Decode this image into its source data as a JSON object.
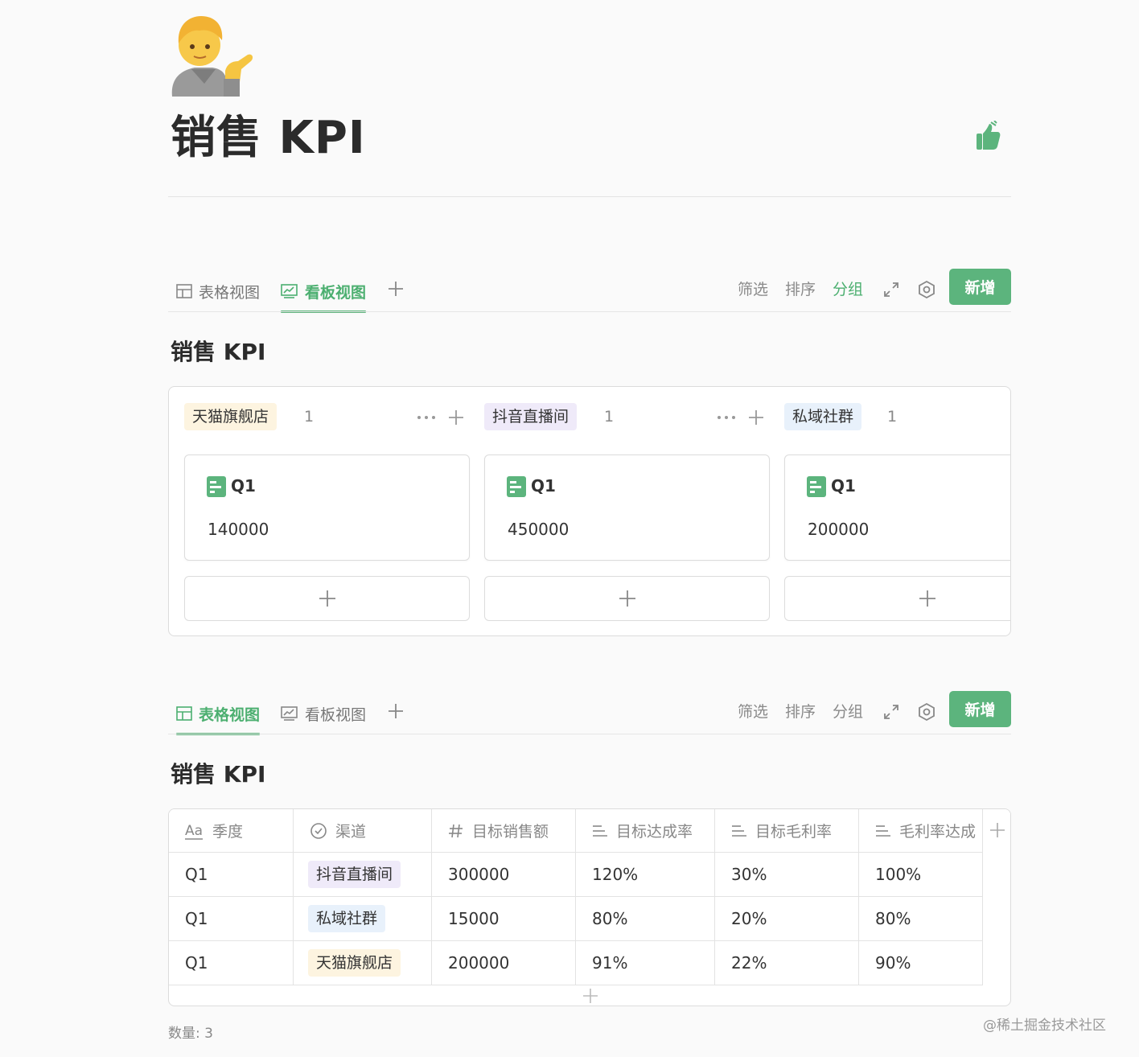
{
  "page": {
    "title": "销售 KPI",
    "icon": "person-tipping-hand-emoji",
    "top_right_icon": "thumbs-up-icon"
  },
  "kanban_view": {
    "tabs": [
      {
        "label": "表格视图",
        "icon": "table-grid-icon",
        "active": false
      },
      {
        "label": "看板视图",
        "icon": "board-icon",
        "active": true
      }
    ],
    "tools": {
      "filter": "筛选",
      "sort": "排序",
      "group": "分组",
      "group_active": true
    },
    "new_label": "新增",
    "section_title": "销售 KPI",
    "columns": [
      {
        "tag": "天猫旗舰店",
        "tag_color": "#fdf4e0",
        "count": "1",
        "card": {
          "title": "Q1",
          "value": "140000"
        }
      },
      {
        "tag": "抖音直播间",
        "tag_color": "#efeaf9",
        "count": "1",
        "card": {
          "title": "Q1",
          "value": "450000"
        }
      },
      {
        "tag": "私域社群",
        "tag_color": "#e8f1fb",
        "count": "1",
        "card": {
          "title": "Q1",
          "value": "200000"
        }
      }
    ]
  },
  "table_view": {
    "tabs": [
      {
        "label": "表格视图",
        "icon": "table-grid-icon",
        "active": true
      },
      {
        "label": "看板视图",
        "icon": "board-icon",
        "active": false
      }
    ],
    "tools": {
      "filter": "筛选",
      "sort": "排序",
      "group": "分组",
      "group_active": false
    },
    "new_label": "新增",
    "section_title": "销售 KPI",
    "columns": [
      {
        "label": "季度",
        "icon": "text-aa-icon"
      },
      {
        "label": "渠道",
        "icon": "check-circle-icon"
      },
      {
        "label": "目标销售额",
        "icon": "hash-icon"
      },
      {
        "label": "目标达成率",
        "icon": "formula-lines-icon"
      },
      {
        "label": "目标毛利率",
        "icon": "formula-lines-icon"
      },
      {
        "label": "毛利率达成",
        "icon": "formula-lines-icon"
      }
    ],
    "rows": [
      {
        "quarter": "Q1",
        "channel": "抖音直播间",
        "channel_color": "#efeaf9",
        "sales": "300000",
        "rate": "120%",
        "margin": "30%",
        "margin_rate": "100%"
      },
      {
        "quarter": "Q1",
        "channel": "私域社群",
        "channel_color": "#e8f1fb",
        "sales": "15000",
        "rate": "80%",
        "margin": "20%",
        "margin_rate": "80%"
      },
      {
        "quarter": "Q1",
        "channel": "天猫旗舰店",
        "channel_color": "#fdf4e0",
        "sales": "200000",
        "rate": "91%",
        "margin": "22%",
        "margin_rate": "90%"
      }
    ],
    "count_label": "数量: 3"
  },
  "watermark": "@稀土掘金技术社区",
  "colors": {
    "accent": "#5cb47d",
    "text": "#333333"
  }
}
